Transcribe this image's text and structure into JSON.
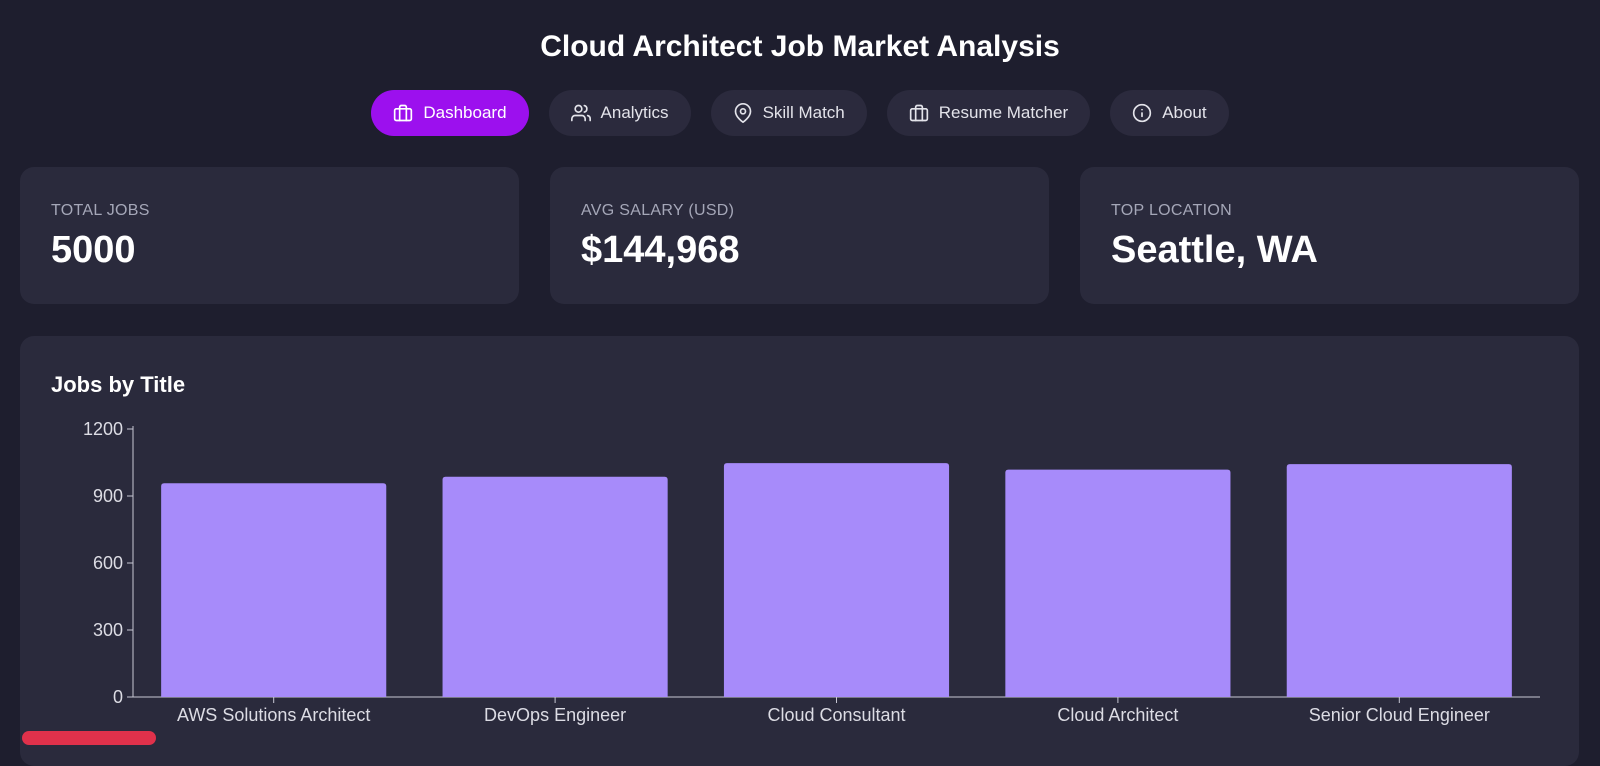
{
  "app": {
    "title": "Cloud Architect Job Market Analysis"
  },
  "nav": {
    "items": [
      {
        "label": "Dashboard",
        "icon": "briefcase-icon",
        "active": true
      },
      {
        "label": "Analytics",
        "icon": "users-icon",
        "active": false
      },
      {
        "label": "Skill Match",
        "icon": "map-pin-icon",
        "active": false
      },
      {
        "label": "Resume Matcher",
        "icon": "briefcase-icon",
        "active": false
      },
      {
        "label": "About",
        "icon": "info-icon",
        "active": false
      }
    ]
  },
  "stats": {
    "total_jobs": {
      "label": "TOTAL JOBS",
      "value": "5000"
    },
    "avg_salary": {
      "label": "AVG SALARY (USD)",
      "value": "$144,968"
    },
    "top_location": {
      "label": "TOP LOCATION",
      "value": "Seattle, WA"
    }
  },
  "colors": {
    "background": "#1e1e2e",
    "card": "#2a2a3c",
    "accent": "#9c10ee",
    "bar": "#a78bfa"
  },
  "chart_data": {
    "type": "bar",
    "title": "Jobs by Title",
    "categories": [
      "AWS Solutions Architect",
      "DevOps Engineer",
      "Cloud Consultant",
      "Cloud Architect",
      "Senior Cloud Engineer"
    ],
    "values": [
      957,
      986,
      1047,
      1018,
      1043
    ],
    "ylim": [
      0,
      1200
    ],
    "yticks": [
      0,
      300,
      600,
      900,
      1200
    ],
    "xlabel": "",
    "ylabel": "",
    "grid": false
  }
}
